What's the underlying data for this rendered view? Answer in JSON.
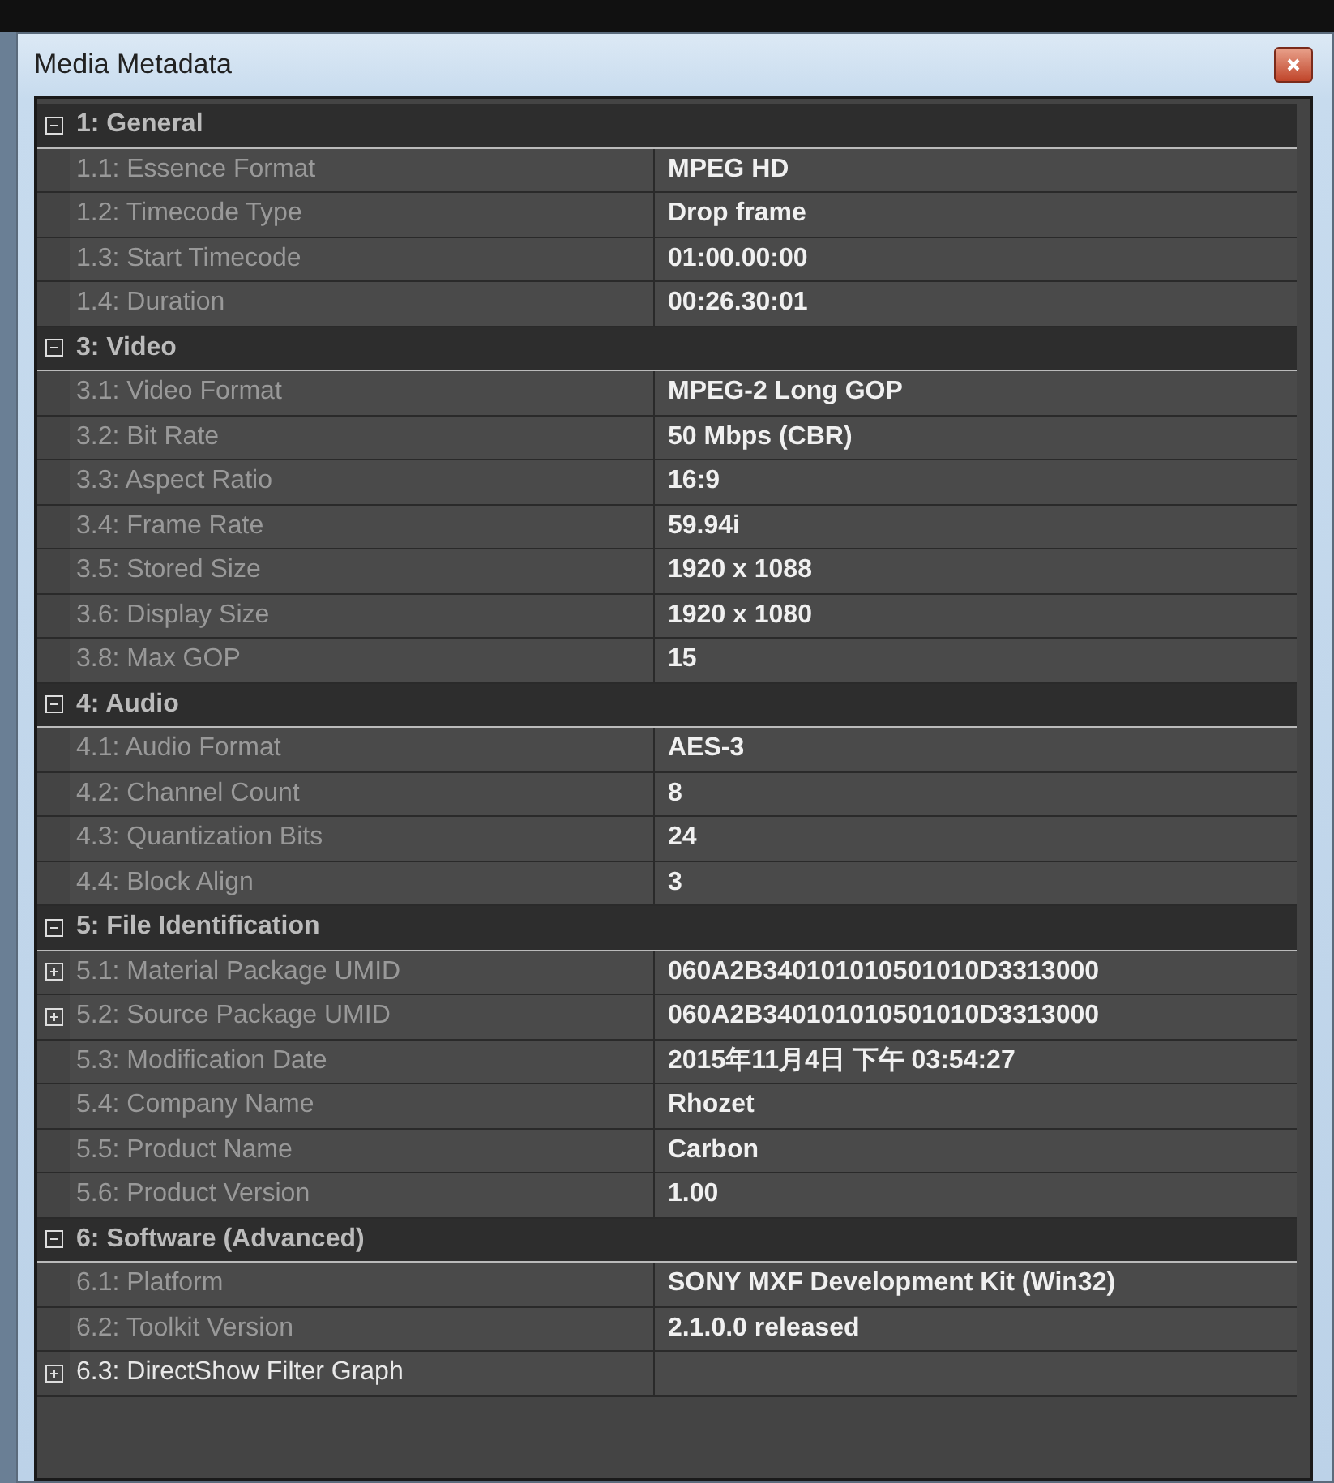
{
  "window": {
    "title": "Media Metadata"
  },
  "sections": [
    {
      "label": "1: General",
      "expanded": true,
      "items": [
        {
          "label": "1.1: Essence Format",
          "value": "MPEG HD",
          "readonly": true
        },
        {
          "label": "1.2: Timecode Type",
          "value": "Drop frame",
          "readonly": true
        },
        {
          "label": "1.3: Start Timecode",
          "value": "01:00.00:00",
          "readonly": true
        },
        {
          "label": "1.4: Duration",
          "value": "00:26.30:01",
          "readonly": true
        }
      ]
    },
    {
      "label": "3: Video",
      "expanded": true,
      "items": [
        {
          "label": "3.1: Video Format",
          "value": "MPEG-2 Long GOP",
          "readonly": true
        },
        {
          "label": "3.2: Bit Rate",
          "value": "50 Mbps (CBR)",
          "readonly": true
        },
        {
          "label": "3.3: Aspect Ratio",
          "value": "16:9",
          "readonly": true
        },
        {
          "label": "3.4: Frame Rate",
          "value": "59.94i",
          "readonly": true
        },
        {
          "label": "3.5: Stored Size",
          "value": "1920 x 1088",
          "readonly": true
        },
        {
          "label": "3.6: Display Size",
          "value": "1920 x 1080",
          "readonly": true
        },
        {
          "label": "3.8: Max GOP",
          "value": "15",
          "readonly": true
        }
      ]
    },
    {
      "label": "4: Audio",
      "expanded": true,
      "items": [
        {
          "label": "4.1: Audio Format",
          "value": "AES-3",
          "readonly": true
        },
        {
          "label": "4.2: Channel Count",
          "value": "8",
          "readonly": true
        },
        {
          "label": "4.3: Quantization Bits",
          "value": "24",
          "readonly": true
        },
        {
          "label": "4.4: Block Align",
          "value": "3",
          "readonly": true
        }
      ]
    },
    {
      "label": "5: File Identification",
      "expanded": true,
      "items": [
        {
          "label": "5.1: Material Package UMID",
          "value": "060A2B340101010501010D3313000",
          "readonly": true,
          "expanded": false
        },
        {
          "label": "5.2: Source Package UMID",
          "value": "060A2B340101010501010D3313000",
          "readonly": true,
          "expanded": false
        },
        {
          "label": "5.3: Modification Date",
          "value": "2015年11月4日 下午 03:54:27",
          "readonly": true
        },
        {
          "label": "5.4: Company Name",
          "value": "Rhozet",
          "readonly": true
        },
        {
          "label": "5.5: Product Name",
          "value": "Carbon",
          "readonly": true
        },
        {
          "label": "5.6: Product Version",
          "value": "1.00",
          "readonly": true
        }
      ]
    },
    {
      "label": "6: Software (Advanced)",
      "expanded": true,
      "items": [
        {
          "label": "6.1: Platform",
          "value": "SONY MXF Development Kit (Win32)",
          "readonly": true
        },
        {
          "label": "6.2: Toolkit Version",
          "value": "2.1.0.0 released",
          "readonly": true
        },
        {
          "label": "6.3: DirectShow Filter Graph",
          "readonly": false,
          "expanded": false
        }
      ]
    }
  ]
}
